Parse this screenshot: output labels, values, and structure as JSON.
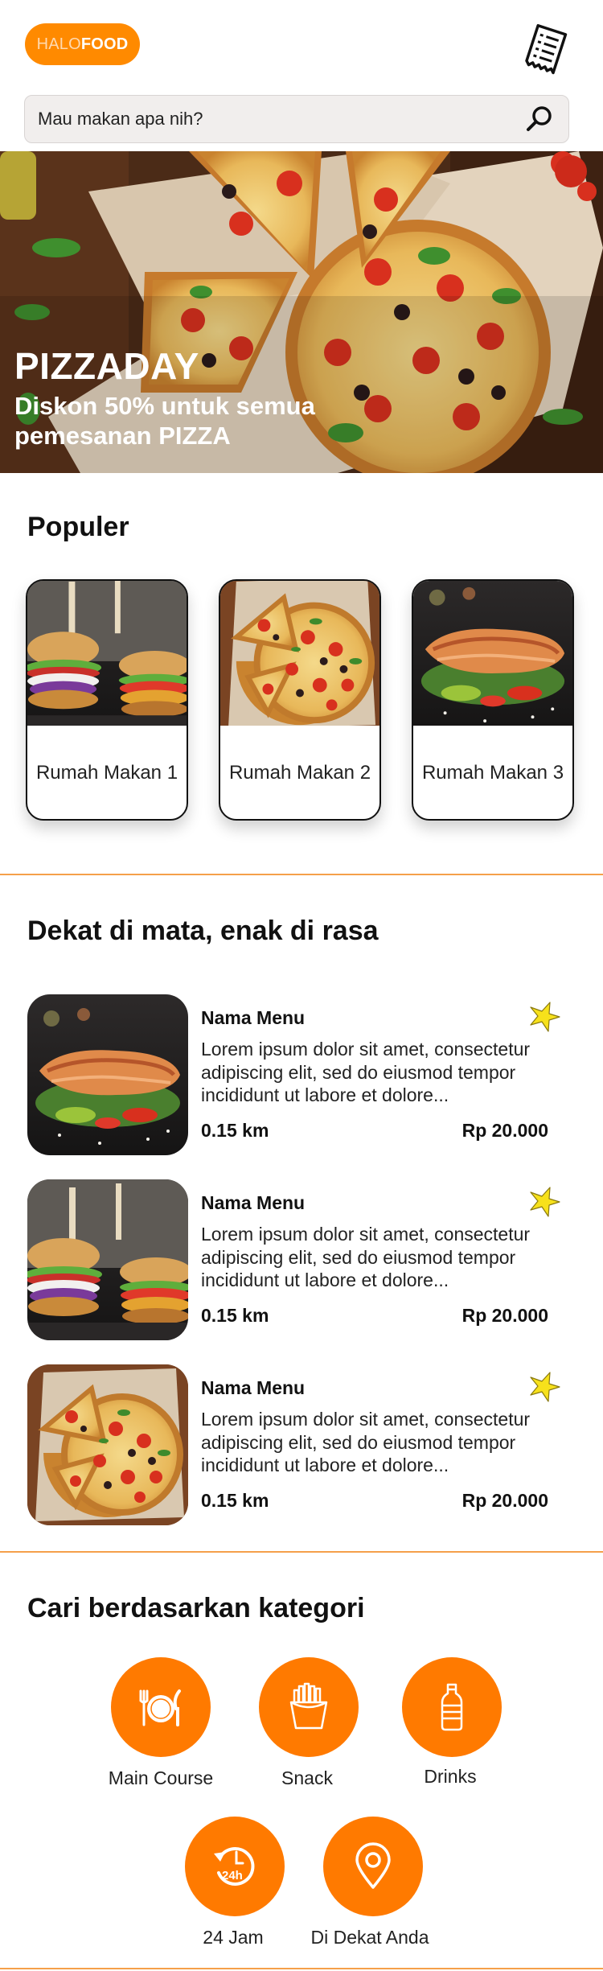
{
  "header": {
    "logo_light": "HALO",
    "logo_bold": "FOOD",
    "receipt_icon": "receipt-icon"
  },
  "search": {
    "placeholder": "Mau makan apa nih?",
    "icon": "search-icon"
  },
  "banner": {
    "title": "PIZZADAY",
    "subtitle": "Diskon 50% untuk semua pemesanan PIZZA"
  },
  "popular": {
    "title": "Populer",
    "items": [
      {
        "name": "Rumah Makan 1",
        "image": "burger"
      },
      {
        "name": "Rumah Makan 2",
        "image": "pizza"
      },
      {
        "name": "Rumah Makan 3",
        "image": "salmon"
      }
    ]
  },
  "nearby": {
    "title": "Dekat di mata, enak di rasa",
    "items": [
      {
        "name": "Nama Menu",
        "desc": "Lorem ipsum dolor sit amet, consectetur adipiscing elit, sed do eiusmod tempor incididunt ut labore et dolore...",
        "distance": "0.15 km",
        "price": "Rp 20.000",
        "image": "salmon"
      },
      {
        "name": "Nama Menu",
        "desc": "Lorem ipsum dolor sit amet, consectetur adipiscing elit, sed do eiusmod tempor incididunt ut labore et dolore...",
        "distance": "0.15 km",
        "price": "Rp 20.000",
        "image": "burger"
      },
      {
        "name": "Nama Menu",
        "desc": "Lorem ipsum dolor sit amet, consectetur adipiscing elit, sed do eiusmod tempor incididunt ut labore et dolore...",
        "distance": "0.15 km",
        "price": "Rp 20.000",
        "image": "pizza"
      }
    ]
  },
  "categories": {
    "title": "Cari berdasarkan kategori",
    "items": [
      {
        "label": "Main Course",
        "icon": "plate-cutlery-icon"
      },
      {
        "label": "Snack",
        "icon": "fries-icon"
      },
      {
        "label": "Drinks",
        "icon": "bottle-icon"
      },
      {
        "label": "24 Jam",
        "icon": "clock-24h-icon"
      },
      {
        "label": "Di Dekat Anda",
        "icon": "location-pin-icon"
      }
    ]
  },
  "colors": {
    "accent": "#FF7A00",
    "logo_bg": "#FF8A00",
    "divider": "#F5A04A",
    "star": "#F7E11B"
  }
}
